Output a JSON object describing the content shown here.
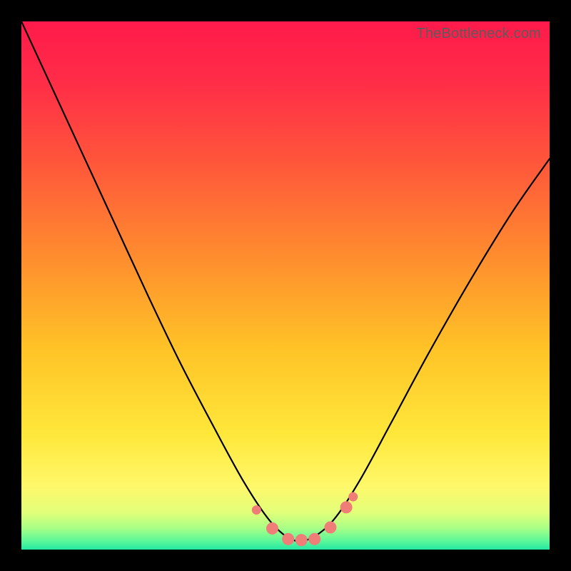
{
  "watermark": "TheBottleneck.com",
  "colors": {
    "frame": "#000000",
    "curve": "#000000",
    "marker_fill": "#ef7e78",
    "marker_stroke": "#ef7e78",
    "gradient_stops": [
      {
        "offset": 0.0,
        "color": "#ff1a4b"
      },
      {
        "offset": 0.12,
        "color": "#ff2e47"
      },
      {
        "offset": 0.28,
        "color": "#ff5a3a"
      },
      {
        "offset": 0.45,
        "color": "#ff8e2e"
      },
      {
        "offset": 0.62,
        "color": "#ffc327"
      },
      {
        "offset": 0.78,
        "color": "#ffe73a"
      },
      {
        "offset": 0.88,
        "color": "#fff86a"
      },
      {
        "offset": 0.93,
        "color": "#e2ff7a"
      },
      {
        "offset": 0.96,
        "color": "#a6ff86"
      },
      {
        "offset": 0.985,
        "color": "#57f79b"
      },
      {
        "offset": 1.0,
        "color": "#24e6a1"
      }
    ]
  },
  "chart_data": {
    "type": "line",
    "title": "",
    "xlabel": "",
    "ylabel": "",
    "xlim": [
      0,
      1
    ],
    "ylim": [
      0,
      1
    ],
    "grid": false,
    "legend": false,
    "note": "Bottleneck curve — V-shaped black line with pink markers near the trough. Axes are unlabeled; values are normalized positions within the plot area.",
    "series": [
      {
        "name": "bottleneck-curve",
        "x": [
          0.0,
          0.06,
          0.12,
          0.18,
          0.24,
          0.3,
          0.36,
          0.42,
          0.47,
          0.51,
          0.545,
          0.59,
          0.64,
          0.7,
          0.77,
          0.85,
          0.93,
          1.0
        ],
        "y": [
          1.0,
          0.87,
          0.74,
          0.61,
          0.48,
          0.355,
          0.24,
          0.13,
          0.055,
          0.02,
          0.02,
          0.055,
          0.13,
          0.24,
          0.37,
          0.51,
          0.64,
          0.74
        ]
      }
    ],
    "markers": [
      {
        "x": 0.445,
        "y": 0.075
      },
      {
        "x": 0.475,
        "y": 0.04
      },
      {
        "x": 0.505,
        "y": 0.02
      },
      {
        "x": 0.53,
        "y": 0.018
      },
      {
        "x": 0.555,
        "y": 0.02
      },
      {
        "x": 0.585,
        "y": 0.042
      },
      {
        "x": 0.615,
        "y": 0.08
      },
      {
        "x": 0.628,
        "y": 0.1
      }
    ]
  }
}
